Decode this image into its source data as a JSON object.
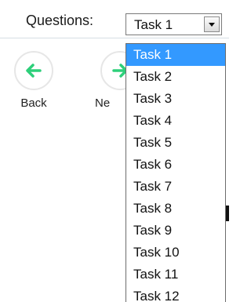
{
  "topbar": {
    "label": "Questions:",
    "selected_value": "Task 1"
  },
  "toolbar": {
    "back_label": "Back",
    "next_label": "Ne",
    "back_icon": "arrow-left-icon",
    "next_icon": "arrow-right-icon",
    "icon_color": "#2ecf7a"
  },
  "dropdown": {
    "options": [
      "Task 1",
      "Task 2",
      "Task 3",
      "Task 4",
      "Task 5",
      "Task 6",
      "Task 7",
      "Task 8",
      "Task 9",
      "Task 10",
      "Task 11",
      "Task 12"
    ],
    "selected_index": 0,
    "highlight_color": "#3399ff"
  }
}
